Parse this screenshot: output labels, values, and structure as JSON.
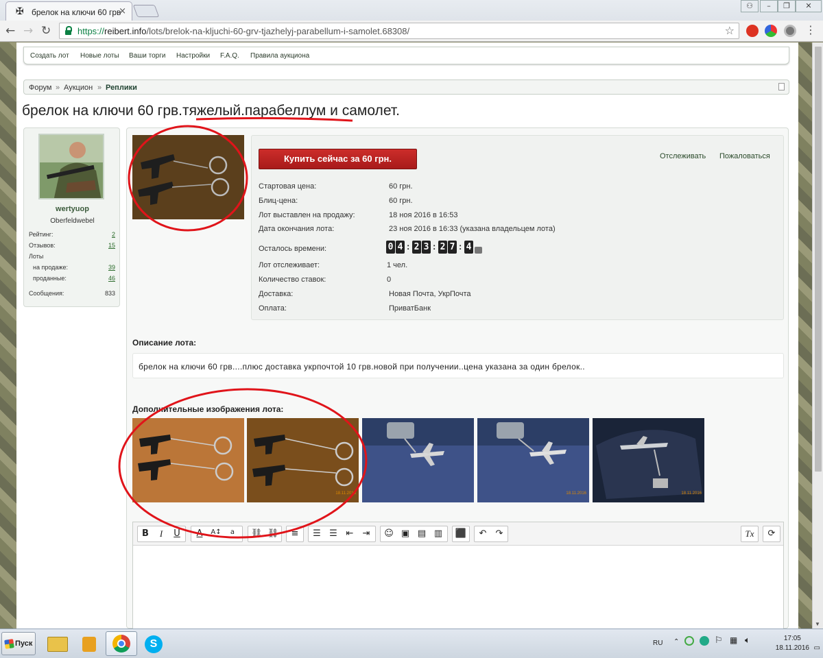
{
  "browser": {
    "tab_title": "брелок на ключи 60 грв.",
    "url_scheme": "https://",
    "url_host": "reibert.info",
    "url_path": "/lots/brelok-na-kljuchi-60-grv-tjazhelyj-parabellum-i-samolet.68308/"
  },
  "topnav": [
    "Создать лот",
    "Новые лоты",
    "Ваши торги",
    "Настройки",
    "F.A.Q.",
    "Правила аукциона"
  ],
  "breadcrumbs": {
    "items": [
      "Форум",
      "Аукцион"
    ],
    "current": "Реплики",
    "separator": "»"
  },
  "title": {
    "part1": "брелок на ключи 60 грв",
    "part2": ".тяжелый.парабеллум",
    "part3": " и самолет."
  },
  "seller": {
    "username": "wertyuop",
    "rank": "Oberfeldwebel",
    "stats": [
      {
        "label": "Рейтинг:",
        "value": "2"
      },
      {
        "label": "Отзывов:",
        "value": "15"
      },
      {
        "label": "Лоты",
        "value": ""
      },
      {
        "label": "на продаже:",
        "value": "39"
      },
      {
        "label": "проданные:",
        "value": "46"
      },
      {
        "label": "Сообщения:",
        "value": "833"
      }
    ]
  },
  "lot": {
    "buy_button": "Купить сейчас за 60 грн.",
    "watch_link": "Отслеживать",
    "report_link": "Пожаловаться",
    "fields": [
      {
        "k": "Стартовая цена:",
        "v": "60 грн."
      },
      {
        "k": "Блиц-цена:",
        "v": "60 грн."
      },
      {
        "k": "Лот выставлен на продажу:",
        "v": "18 ноя 2016 в 16:53"
      },
      {
        "k": "Дата окончания лота:",
        "v": "23 ноя 2016 в 16:33 (указана владельцем лота)"
      },
      {
        "k": "Осталось времени:",
        "v": ""
      },
      {
        "k": "Лот отслеживает:",
        "v": "1 чел."
      },
      {
        "k": "Количество ставок:",
        "v": "0"
      },
      {
        "k": "Доставка:",
        "v": "Новая Почта, УкрПочта"
      },
      {
        "k": "Оплата:",
        "v": "ПриватБанк"
      }
    ],
    "countdown": [
      "0",
      "4",
      "2",
      "3",
      "2",
      "7",
      "4"
    ]
  },
  "description": {
    "heading": "Описание лота:",
    "text": "брелок на ключи 60 грв....плюс доставка укрпочтой 10 грв.новой при получении..цена указана за один брелок.."
  },
  "additional_images": {
    "heading": "Дополнительные изображения лота:",
    "dates": [
      "18.11.2016",
      "18.11.2016",
      "18.11.2016"
    ]
  },
  "taskbar": {
    "start": "Пуск",
    "lang": "RU",
    "time": "17:05",
    "date": "18.11.2016"
  },
  "colors": {
    "buy": "#b52220",
    "annotation": "#e0141a",
    "page_bg": "#ffffff"
  }
}
